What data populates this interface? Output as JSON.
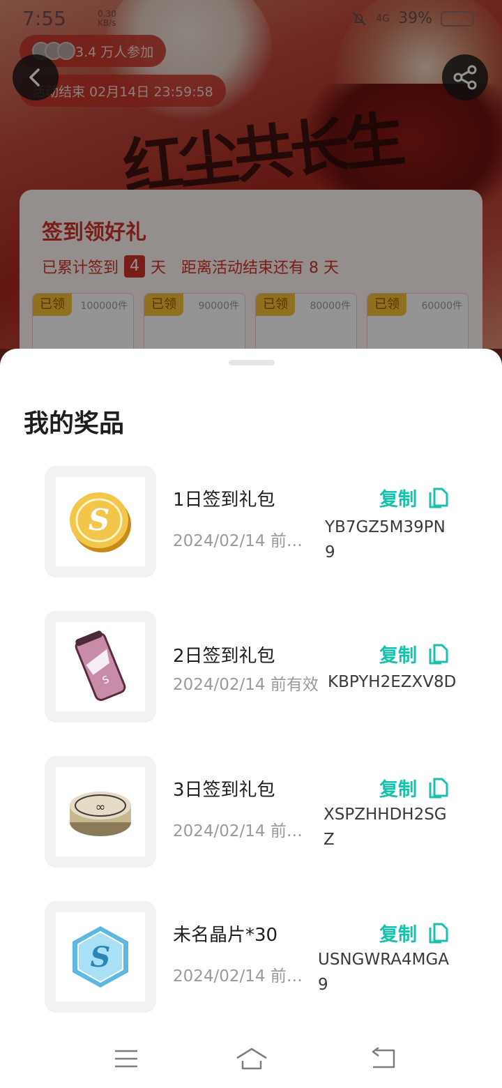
{
  "status": {
    "time": "7:55",
    "net_speed": "0.30",
    "net_unit": "KB/s",
    "signal": "4G",
    "battery": "39%"
  },
  "banner": {
    "calligraphy": "红尘共长生"
  },
  "header": {
    "participants": "3.4 万人参加",
    "end_time": "活动结束 02月14日 23:59:58"
  },
  "checkin": {
    "title": "签到领好礼",
    "sub_prefix": "已累计签到",
    "days": "4",
    "sub_suffix": "天",
    "remaining": "距离活动结束还有 8 天",
    "gifts": [
      {
        "tag": "已领",
        "count": "100000件"
      },
      {
        "tag": "已领",
        "count": "90000件"
      },
      {
        "tag": "已领",
        "count": "80000件"
      },
      {
        "tag": "已领",
        "count": "60000件"
      }
    ]
  },
  "sheet": {
    "title": "我的奖品",
    "copy_label": "复制",
    "prizes": [
      {
        "name": "1日签到礼包",
        "date": "2024/02/14 前…",
        "code_line1": "YB7GZ5M39PN",
        "code_line2": "9",
        "icon": "coin-icon"
      },
      {
        "name": "2日签到礼包",
        "date": "2024/02/14 前有效",
        "code_line1": "KBPYH2EZXV8D",
        "code_line2": "",
        "icon": "can-icon"
      },
      {
        "name": "3日签到礼包",
        "date": "2024/02/14 前…",
        "code_line1": "XSPZHHDH2SG",
        "code_line2": "Z",
        "icon": "tin-icon"
      },
      {
        "name": "未名晶片*30",
        "date": "2024/02/14 前…",
        "code_line1": "USNGWRA4MGA",
        "code_line2": "9",
        "icon": "crystal-icon"
      }
    ]
  },
  "colors": {
    "accent": "#18c1ac",
    "brand_red": "#d0322a",
    "tag_yellow": "#f6c238"
  }
}
